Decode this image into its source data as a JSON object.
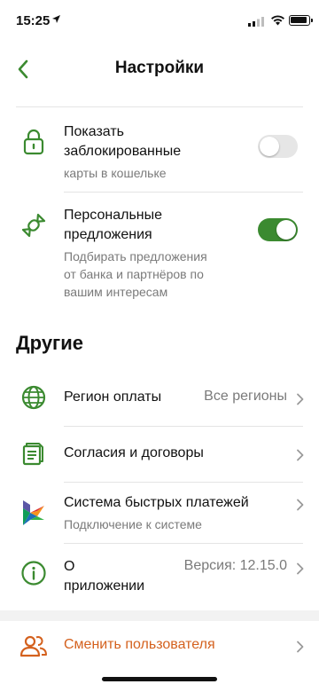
{
  "status_bar": {
    "time": "15:25"
  },
  "nav": {
    "title": "Настройки"
  },
  "toggles": [
    {
      "title": "Показать заблокированные",
      "title_line1": "Показать",
      "title_line2": "заблокированные",
      "subtitle": "карты в кошельке",
      "state": "off"
    },
    {
      "title": "Персональные предложения",
      "title_line1": "Персональные",
      "title_line2": "предложения",
      "subtitle_lines": [
        "Подбирать предложения",
        "от банка и партнёров по",
        "вашим интересам"
      ],
      "state": "on"
    }
  ],
  "section": {
    "title": "Другие"
  },
  "items": [
    {
      "label": "Регион оплаты",
      "value": "Все регионы",
      "icon": "globe-icon"
    },
    {
      "label": "Согласия и договоры",
      "icon": "documents-icon"
    },
    {
      "label": "Система быстрых платежей",
      "subtitle": "Подключение к системе",
      "icon": "sbp-logo-icon"
    },
    {
      "label_line1": "О",
      "label_line2": "приложении",
      "value": "Версия: 12.15.0",
      "icon": "info-icon"
    }
  ],
  "switch_user": {
    "label": "Сменить пользователя",
    "icon": "users-icon"
  },
  "colors": {
    "accent_green": "#3b8a30",
    "danger_orange": "#d4611e",
    "secondary_text": "#7a7a7a"
  }
}
